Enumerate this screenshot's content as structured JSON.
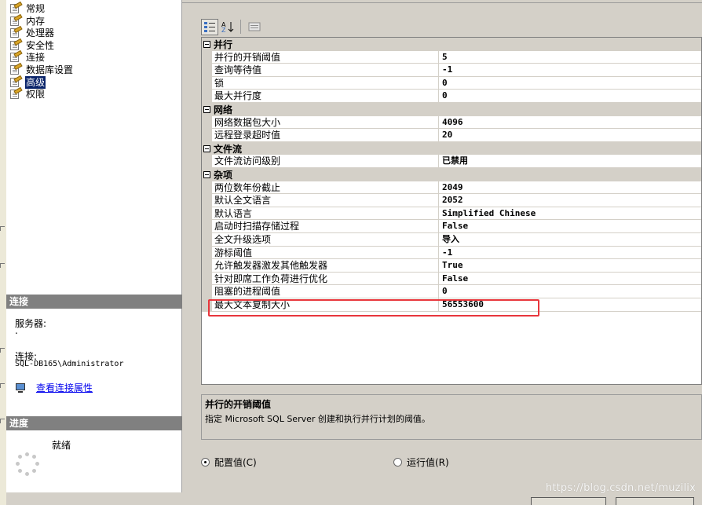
{
  "pages": [
    {
      "label": "常规",
      "selected": false
    },
    {
      "label": "内存",
      "selected": false
    },
    {
      "label": "处理器",
      "selected": false
    },
    {
      "label": "安全性",
      "selected": false
    },
    {
      "label": "连接",
      "selected": false
    },
    {
      "label": "数据库设置",
      "selected": false
    },
    {
      "label": "高级",
      "selected": true
    },
    {
      "label": "权限",
      "selected": false
    }
  ],
  "connection": {
    "header": "连接",
    "server_label": "服务器:",
    "server_value": ".",
    "connection_label": "连接:",
    "connection_value": "SQL-DB165\\Administrator",
    "view_properties_link": "查看连接属性"
  },
  "progress": {
    "header": "进度",
    "status": "就绪"
  },
  "toolbar": {
    "categorized_icon": "categorized-icon",
    "alphabetical_icon": "alphabetical-icon",
    "property_pages_icon": "property-pages-icon"
  },
  "categories": [
    {
      "name": "并行",
      "props": [
        {
          "name": "并行的开销阈值",
          "value": "5"
        },
        {
          "name": "查询等待值",
          "value": "-1"
        },
        {
          "name": "锁",
          "value": "0"
        },
        {
          "name": "最大并行度",
          "value": "0"
        }
      ]
    },
    {
      "name": "网络",
      "props": [
        {
          "name": "网络数据包大小",
          "value": "4096"
        },
        {
          "name": "远程登录超时值",
          "value": "20"
        }
      ]
    },
    {
      "name": "文件流",
      "props": [
        {
          "name": "文件流访问级别",
          "value": "已禁用"
        }
      ]
    },
    {
      "name": "杂项",
      "props": [
        {
          "name": "两位数年份截止",
          "value": "2049"
        },
        {
          "name": "默认全文语言",
          "value": "2052"
        },
        {
          "name": "默认语言",
          "value": "Simplified Chinese"
        },
        {
          "name": "启动时扫描存储过程",
          "value": "False"
        },
        {
          "name": "全文升级选项",
          "value": "导入"
        },
        {
          "name": "游标阈值",
          "value": "-1"
        },
        {
          "name": "允许触发器激发其他触发器",
          "value": "True"
        },
        {
          "name": "针对即席工作负荷进行优化",
          "value": "False"
        },
        {
          "name": "阻塞的进程阈值",
          "value": "0"
        },
        {
          "name": "最大文本复制大小",
          "value": "56553600"
        }
      ]
    }
  ],
  "description": {
    "title": "并行的开销阈值",
    "text": "指定 Microsoft SQL Server 创建和执行并行计划的阈值。"
  },
  "radios": {
    "configured": {
      "label": "配置值(C)",
      "checked": true
    },
    "running": {
      "label": "运行值(R)",
      "checked": false
    }
  },
  "watermark": "https://blog.csdn.net/muzilix",
  "colors": {
    "selection": "#0a246a",
    "highlight_box": "#e8363c",
    "link": "#0000ee"
  }
}
